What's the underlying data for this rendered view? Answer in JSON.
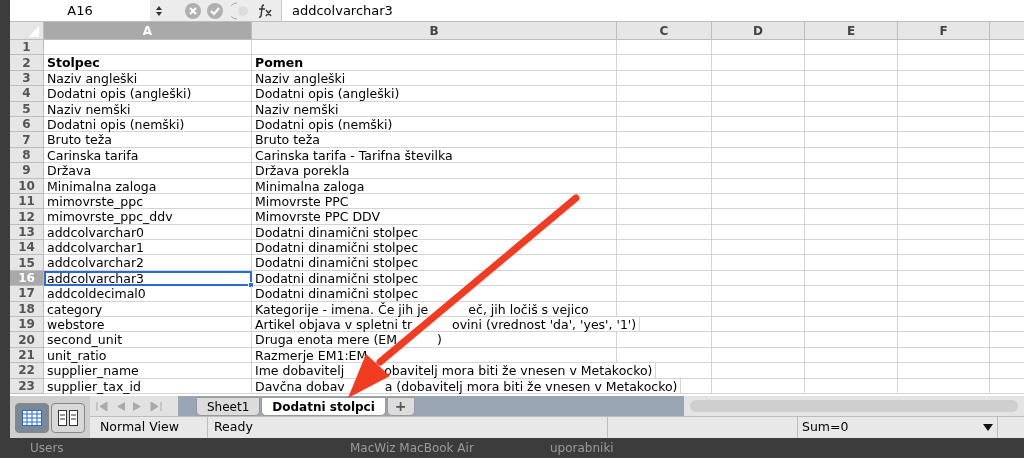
{
  "formula_bar": {
    "cell_ref": "A16",
    "formula": "addcolvarchar3"
  },
  "columns": [
    {
      "label": "A",
      "selected": true
    },
    {
      "label": "B",
      "selected": false
    },
    {
      "label": "C",
      "selected": false
    },
    {
      "label": "D",
      "selected": false
    },
    {
      "label": "E",
      "selected": false
    },
    {
      "label": "F",
      "selected": false
    }
  ],
  "rows": [
    {
      "number": "1",
      "kind": "data",
      "selected": false
    },
    {
      "number": "2",
      "kind": "heading",
      "selected": false,
      "a": "Stolpec",
      "b": "Pomen"
    },
    {
      "number": "3",
      "kind": "data",
      "selected": false,
      "a": "Naziv angleški",
      "b": "Naziv angleški"
    },
    {
      "number": "4",
      "kind": "data",
      "selected": false,
      "a": "Dodatni opis (angleški)",
      "b": "Dodatni opis (angleški)"
    },
    {
      "number": "5",
      "kind": "data",
      "selected": false,
      "a": "Naziv nemški",
      "b": "Naziv nemški"
    },
    {
      "number": "6",
      "kind": "data",
      "selected": false,
      "a": "Dodatni opis (nemški)",
      "b": "Dodatni opis (nemški)"
    },
    {
      "number": "7",
      "kind": "data",
      "selected": false,
      "a": "Bruto teža",
      "b": "Bruto teža"
    },
    {
      "number": "8",
      "kind": "data",
      "selected": false,
      "a": "Carinska tarifa",
      "b": "Carinska tarifa - Tarifna številka"
    },
    {
      "number": "9",
      "kind": "data",
      "selected": false,
      "a": "Država",
      "b": "Država porekla"
    },
    {
      "number": "10",
      "kind": "data",
      "selected": false,
      "a": "Minimalna zaloga",
      "b": "Minimalna zaloga"
    },
    {
      "number": "11",
      "kind": "data",
      "selected": false,
      "a": "mimovrste_ppc",
      "b": "Mimovrste PPC"
    },
    {
      "number": "12",
      "kind": "data",
      "selected": false,
      "a": "mimovrste_ppc_ddv",
      "b": "Mimovrste PPC DDV"
    },
    {
      "number": "13",
      "kind": "data",
      "selected": false,
      "a": "addcolvarchar0",
      "b": "Dodatni dinamični stolpec"
    },
    {
      "number": "14",
      "kind": "data",
      "selected": false,
      "a": "addcolvarchar1",
      "b": "Dodatni dinamični stolpec"
    },
    {
      "number": "15",
      "kind": "data",
      "selected": false,
      "a": "addcolvarchar2",
      "b": "Dodatni dinamični stolpec"
    },
    {
      "number": "16",
      "kind": "data",
      "selected": true,
      "a": "addcolvarchar3",
      "b": "Dodatni dinamični stolpec"
    },
    {
      "number": "17",
      "kind": "data",
      "selected": false,
      "a": "addcoldecimal0",
      "b": "Dodatni dinamični stolpec"
    },
    {
      "number": "18",
      "kind": "data",
      "selected": false,
      "a": "category",
      "b": [
        "Kategorije - imena. Če jih je",
        "eč, jih ločiš s vejico"
      ]
    },
    {
      "number": "19",
      "kind": "data",
      "selected": false,
      "a": "webstore",
      "b": [
        "Artikel objava v spletni tr",
        "ovini (vrednost 'da', 'yes', '1')"
      ]
    },
    {
      "number": "20",
      "kind": "data",
      "selected": false,
      "a": "second_unit",
      "b": [
        "Druga enota mere (EM",
        ")"
      ]
    },
    {
      "number": "21",
      "kind": "data",
      "selected": false,
      "a": "unit_ratio",
      "b": [
        "Razmerje EM1:EM"
      ]
    },
    {
      "number": "22",
      "kind": "data",
      "selected": false,
      "a": "supplier_name",
      "b": [
        "Ime dobavitelj",
        "obavitelj mora biti že vnesen v Metakocko)"
      ]
    },
    {
      "number": "23",
      "kind": "data",
      "selected": false,
      "a": "supplier_tax_id",
      "b": [
        "Davčna dobav",
        "a (dobavitelj mora biti že vnesen v Metakocko)"
      ]
    }
  ],
  "view_buttons": [
    {
      "kind": "normal",
      "selected": true
    },
    {
      "kind": "page",
      "selected": false
    }
  ],
  "tabs": [
    {
      "label": "Sheet1",
      "selected": false
    },
    {
      "label": "Dodatni stolpci",
      "selected": true
    }
  ],
  "add_tab": "+",
  "status_bar": {
    "view": "Normal View",
    "status": "Ready",
    "sum": "Sum=0"
  },
  "desktop": [
    "Users",
    "MacWiz MacBook Air",
    "uporabniki"
  ]
}
